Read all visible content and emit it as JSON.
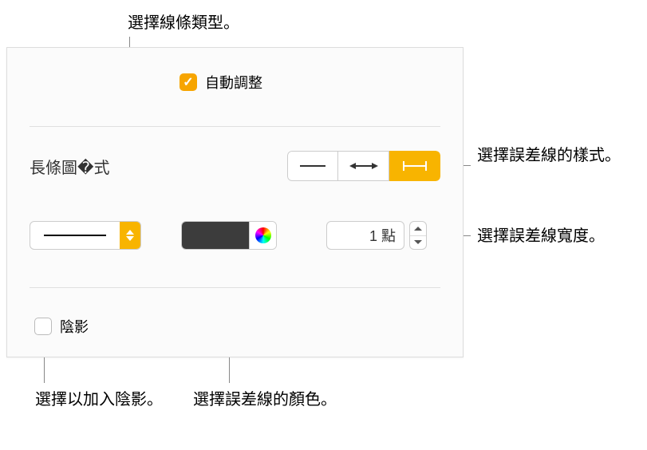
{
  "callouts": {
    "line_type": "選擇線條類型。",
    "bar_style": "選擇誤差線的樣式。",
    "width": "選擇誤差線寬度。",
    "shadow": "選擇以加入陰影。",
    "color": "選擇誤差線的顏色。"
  },
  "panel": {
    "auto_adjust_label": "自動調整",
    "auto_adjust_checked": true,
    "section_bar_style": "長條圖�式",
    "shadow_label": "陰影",
    "shadow_checked": false,
    "width_value": "1 點",
    "colors": {
      "swatch": "#3c3c3c",
      "accent": "#f8b400"
    }
  }
}
